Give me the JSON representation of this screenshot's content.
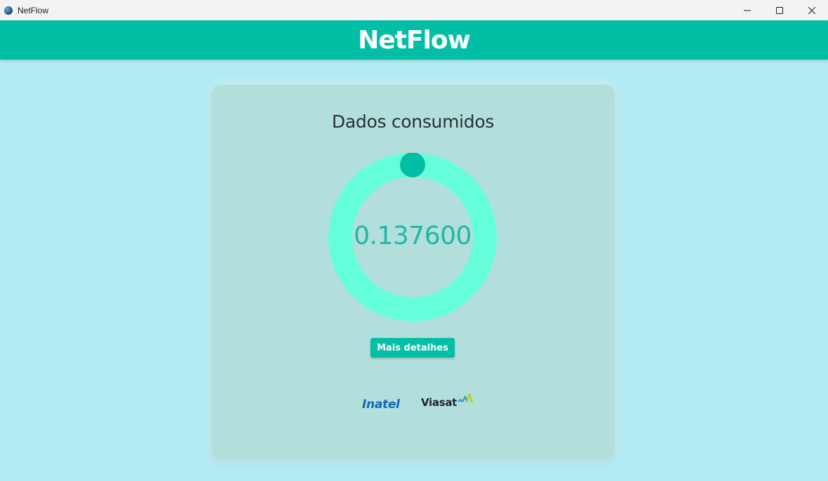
{
  "window": {
    "title": "NetFlow",
    "icon": "globe-icon",
    "controls": [
      "minimize-icon",
      "maximize-icon",
      "close-icon"
    ]
  },
  "header": {
    "title": "NetFlow",
    "background_color": "#00bfa5"
  },
  "card": {
    "title": "Dados consumidos",
    "gauge": {
      "value_text": "0.137600",
      "progress_fraction": 0.0,
      "ring_color": "#64ffda",
      "indicator_color": "#00bfa5"
    },
    "details_button_label": "Mais detalhes"
  },
  "logos": {
    "inatel": "Inatel",
    "viasat": "Viasat"
  },
  "colors": {
    "page_background": "#b2ebf2",
    "card_background": "#b2dfdb",
    "accent": "#00bfa5"
  }
}
